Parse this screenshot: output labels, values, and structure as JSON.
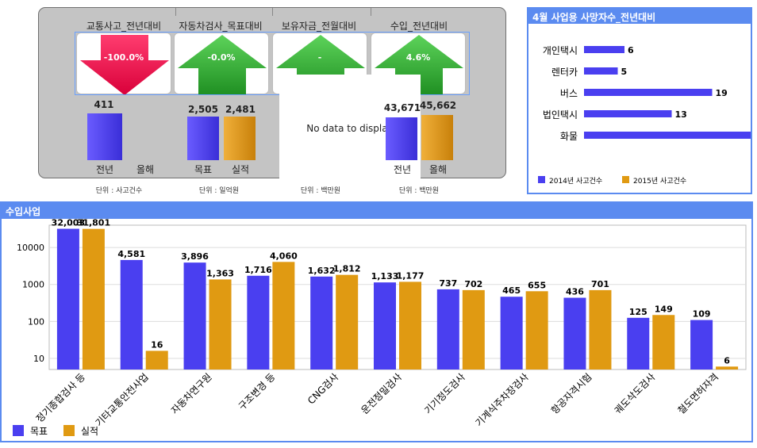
{
  "kpis": [
    {
      "title": "교통사고_전년대비",
      "arrow_value": "-100.0%",
      "direction": "down",
      "unit": "단위 : 사고건수",
      "bars": [
        {
          "label": "전년",
          "value": "411"
        },
        {
          "label": "올해",
          "value": ""
        }
      ]
    },
    {
      "title": "자동차검사_목표대비",
      "arrow_value": "-0.0%",
      "direction": "up",
      "unit": "단위 : 일억원",
      "bars": [
        {
          "label": "목표",
          "value": "2,505"
        },
        {
          "label": "실적",
          "value": "2,481"
        }
      ]
    },
    {
      "title": "보유자금_전월대비",
      "arrow_value": "-",
      "direction": "up",
      "unit": "단위 : 백만원",
      "no_data": "No data to display"
    },
    {
      "title": "수입_전년대비",
      "arrow_value": "4.6%",
      "direction": "up",
      "unit": "단위 : 백만원",
      "bars": [
        {
          "label": "전년",
          "value": "43,671"
        },
        {
          "label": "올해",
          "value": "45,662"
        }
      ]
    }
  ],
  "side": {
    "title": "4월 사업용 사망자수_전년대비",
    "legend": [
      "2014년 사고건수",
      "2015년 사고건수"
    ],
    "items": [
      {
        "label": "개인택시",
        "value": 6
      },
      {
        "label": "렌터카",
        "value": 5
      },
      {
        "label": "버스",
        "value": 19
      },
      {
        "label": "법인택시",
        "value": 13
      },
      {
        "label": "화물",
        "value": 26
      }
    ]
  },
  "bottom": {
    "title": "수입사업",
    "legend": [
      "목표",
      "실적"
    ]
  },
  "chart_data": {
    "type": "bar",
    "title": "수입사업",
    "yscale": "log",
    "ytick_labels": [
      "10",
      "100",
      "1000",
      "10000"
    ],
    "categories": [
      "정기종합검사 등",
      "기타교통안전사업",
      "자동차연구원",
      "구조변경 등",
      "CNG검사",
      "운전정밀검사",
      "기기정도검사",
      "기계식주차장검사",
      "항공자격시험",
      "궤도삭도검사",
      "철도면허자격"
    ],
    "series": [
      {
        "name": "목표",
        "labels": [
          "32,003",
          "4,581",
          "3,896",
          "1,716",
          "1,632",
          "1,133",
          "737",
          "465",
          "436",
          "125",
          "109"
        ],
        "values": [
          32003,
          4581,
          3896,
          1716,
          1632,
          1133,
          737,
          465,
          436,
          125,
          109
        ]
      },
      {
        "name": "실적",
        "labels": [
          "31,801",
          "16",
          "1,363",
          "4,060",
          "1,812",
          "1,177",
          "702",
          "655",
          "701",
          "149",
          "6"
        ],
        "values": [
          31801,
          16,
          1363,
          4060,
          1812,
          1177,
          702,
          655,
          701,
          149,
          6
        ]
      }
    ]
  },
  "colors": {
    "target": "#4a3ff0",
    "actual": "#e09a12",
    "header": "#5b8bf0",
    "down": "#e8104a",
    "up": "#2ca02c"
  }
}
